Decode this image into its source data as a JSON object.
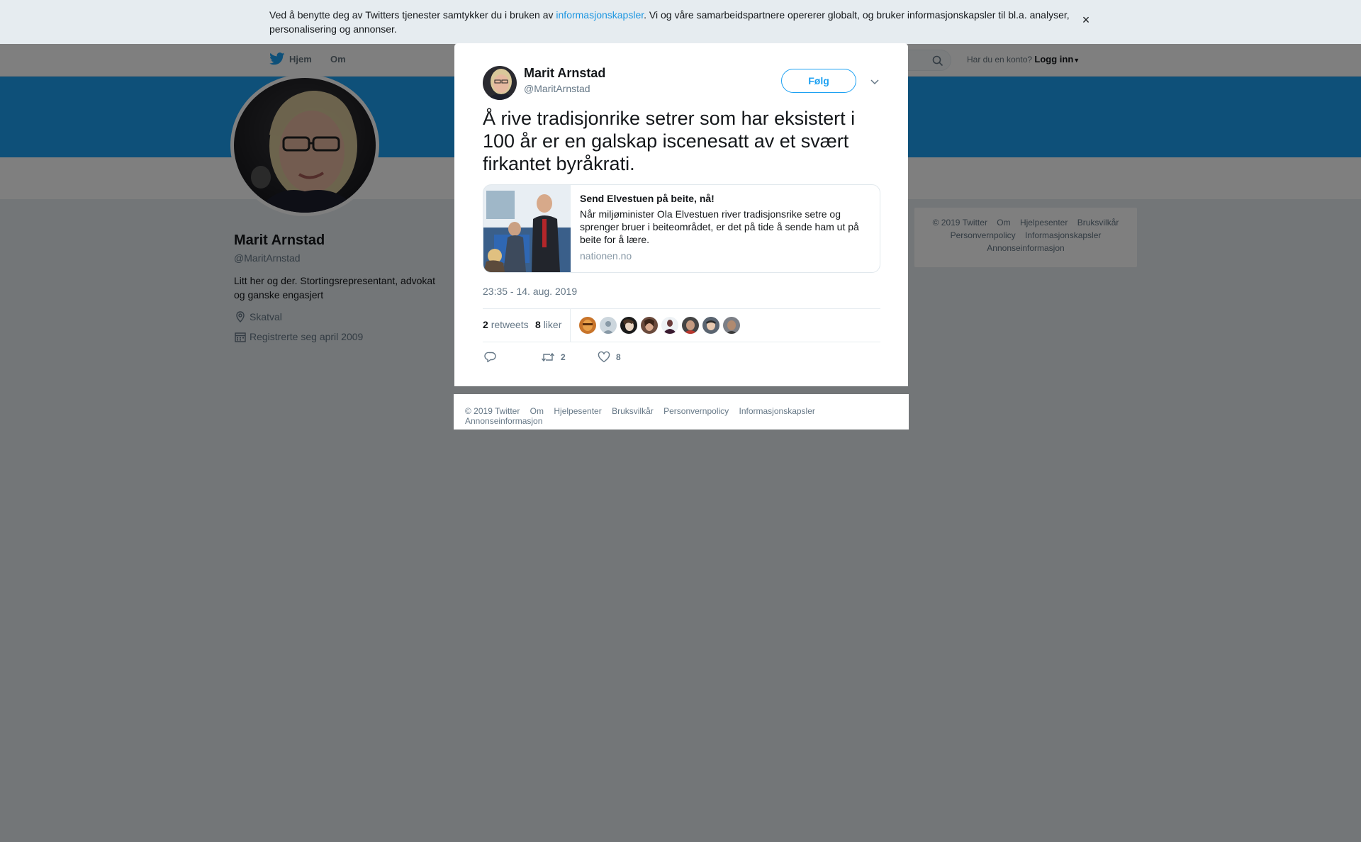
{
  "colors": {
    "accent": "#1da1f2",
    "link": "#1b95e0",
    "muted": "#657786",
    "overlay": "rgba(0,0,0,0.5)"
  },
  "cookie_notice": {
    "text_before": "Ved å benytte deg av Twitters tjenester samtykker du i bruken av ",
    "link_text": "informasjonskapsler",
    "text_after": ". Vi og våre samarbeidspartnere opererer globalt, og bruker informasjonskapsler til bl.a. analyser, personalisering og annonser.",
    "close_glyph": "×"
  },
  "topnav": {
    "home_label": "Hjem",
    "about_label": "Om",
    "login_prompt": "Har du en konto?",
    "login_label": "Logg inn"
  },
  "profile": {
    "name": "Marit Arnstad",
    "handle": "@MaritArnstad",
    "bio": "Litt her og der. Stortingsrepresentant, advokat og ganske engasjert",
    "location": "Skatval",
    "joined": "Registrerte seg april 2009"
  },
  "sidebar_footer": [
    "© 2019 Twitter",
    "Om",
    "Hjelpesenter",
    "Bruksvilkår",
    "Personvernpolicy",
    "Informasjonskapsler",
    "Annonseinformasjon"
  ],
  "tweet": {
    "author_name": "Marit Arnstad",
    "author_handle": "@MaritArnstad",
    "follow_label": "Følg",
    "text": "Å rive tradisjonrike setrer som har eksistert i 100 år er en galskap iscenesatt av et svært firkantet byråkrati.",
    "card": {
      "title": "Send Elvestuen på beite, nå!",
      "description": "Når miljøminister Ola Elvestuen river tradisjonsrike setre og sprenger bruer i beiteområdet, er det på tide å sende ham ut på beite for å lære.",
      "domain": "nationen.no"
    },
    "timestamp": "23:35 - 14. aug. 2019",
    "retweets_count": "2",
    "retweets_label": "retweets",
    "likes_count": "8",
    "likes_label": "liker",
    "actions": {
      "reply_icon": "reply-icon",
      "retweet_count": "2",
      "like_count": "8"
    },
    "liker_avatar_count": 8
  },
  "modal_footer": [
    "© 2019 Twitter",
    "Om",
    "Hjelpesenter",
    "Bruksvilkår",
    "Personvernpolicy",
    "Informasjonskapsler",
    "Annonseinformasjon"
  ],
  "close_glyph": "✕"
}
